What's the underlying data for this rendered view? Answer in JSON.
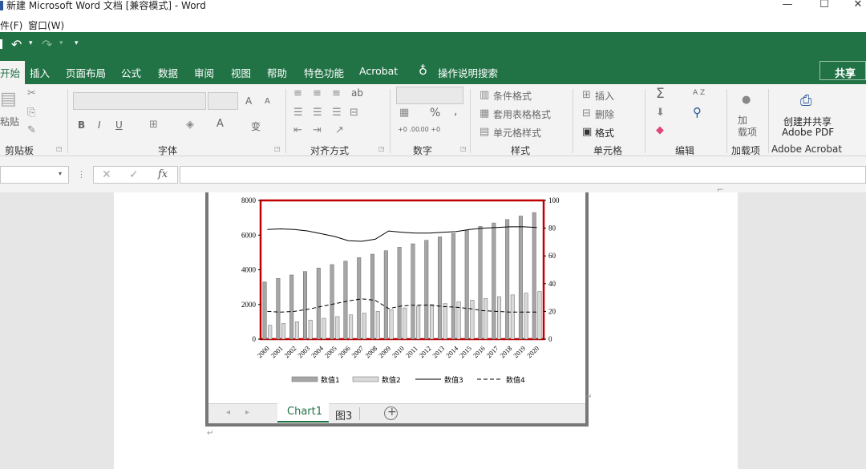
{
  "window": {
    "title": "新建 Microsoft Word 文档 [兼容模式] - Word",
    "controls": {
      "minimize": "—",
      "maximize": "☐",
      "close": "✕"
    }
  },
  "menubar": {
    "items": [
      "件(F)",
      "窗口(W)"
    ]
  },
  "tabs": [
    "开始",
    "插入",
    "页面布局",
    "公式",
    "数据",
    "审阅",
    "视图",
    "帮助",
    "特色功能",
    "Acrobat",
    "操作说明搜索"
  ],
  "share_label": "共享",
  "ribbon": {
    "clipboard": {
      "label": "剪贴板",
      "paste": "粘贴"
    },
    "font": {
      "label": "字体",
      "bold": "B",
      "italic": "I",
      "underline": "U",
      "grow": "A",
      "shrink": "A",
      "color": "A",
      "phonetic": "变"
    },
    "alignment": {
      "label": "对齐方式",
      "wrap": "ab"
    },
    "number": {
      "label": "数字",
      "percent": "%",
      "comma": ",",
      "inc": "+0 .00",
      "dec": ".00 +0"
    },
    "styles": {
      "label": "样式",
      "conditional": "条件格式",
      "table": "套用表格格式",
      "cell": "单元格样式"
    },
    "cells": {
      "label": "单元格",
      "insert": "插入",
      "delete": "删除",
      "format": "格式"
    },
    "editing": {
      "label": "编辑",
      "sum": "Σ",
      "sort": "A Z"
    },
    "addins": {
      "label": "加载项",
      "button": "加\n载项"
    },
    "acrobat": {
      "label": "Adobe Acrobat",
      "button_line1": "创建并共享",
      "button_line2": "Adobe PDF"
    }
  },
  "formula_bar": {
    "namebox": "",
    "cancel": "✕",
    "enter": "✓",
    "fx": "fx",
    "value": ""
  },
  "sheet_tabs": {
    "tabs": [
      "Chart1",
      "图3"
    ],
    "active": "Chart1",
    "add": "+",
    "nav_prev": "◂",
    "nav_next": "▸"
  },
  "paragraph_mark": "↵",
  "chart_data": {
    "type": "bar",
    "categories": [
      "2000",
      "2001",
      "2002",
      "2003",
      "2004",
      "2005",
      "2006",
      "2007",
      "2008",
      "2009",
      "2010",
      "2011",
      "2012",
      "2013",
      "2014",
      "2015",
      "2016",
      "2017",
      "2018",
      "2019",
      "2020"
    ],
    "series": [
      {
        "name": "数值1",
        "type": "bar",
        "axis": "left",
        "color": "#a6a6a6",
        "values": [
          3300,
          3500,
          3700,
          3900,
          4100,
          4300,
          4500,
          4700,
          4900,
          5100,
          5300,
          5500,
          5700,
          5900,
          6100,
          6300,
          6500,
          6700,
          6900,
          7100,
          7300
        ]
      },
      {
        "name": "数值2",
        "type": "bar",
        "axis": "left",
        "color": "#d9d9d9",
        "values": [
          800,
          900,
          1000,
          1100,
          1200,
          1300,
          1400,
          1500,
          1600,
          1700,
          1800,
          1900,
          2000,
          2050,
          2150,
          2250,
          2350,
          2450,
          2550,
          2650,
          2750
        ]
      },
      {
        "name": "数值3",
        "type": "line",
        "axis": "right",
        "style": "solid",
        "color": "#000000",
        "values": [
          79,
          79.5,
          79,
          78,
          76,
          74,
          71,
          70.5,
          72,
          78,
          77,
          76.5,
          76.5,
          77,
          77.5,
          79,
          80,
          80.5,
          81,
          81,
          80.5
        ]
      },
      {
        "name": "数值4",
        "type": "line",
        "axis": "right",
        "style": "dashed",
        "color": "#000000",
        "values": [
          20,
          19.5,
          20,
          21.5,
          23.5,
          25.5,
          27.5,
          29,
          28,
          22,
          24,
          24.5,
          24.5,
          23.5,
          23,
          22,
          20.5,
          20,
          19.5,
          19.5,
          19.5
        ]
      }
    ],
    "ylim_left": [
      0,
      8000
    ],
    "yticks_left": [
      0,
      2000,
      4000,
      6000,
      8000
    ],
    "ylim_right": [
      0,
      100
    ],
    "yticks_right": [
      0,
      20,
      40,
      60,
      80,
      100
    ],
    "legend": "bottom",
    "plot_border_color": "#c00000",
    "grid": false
  }
}
